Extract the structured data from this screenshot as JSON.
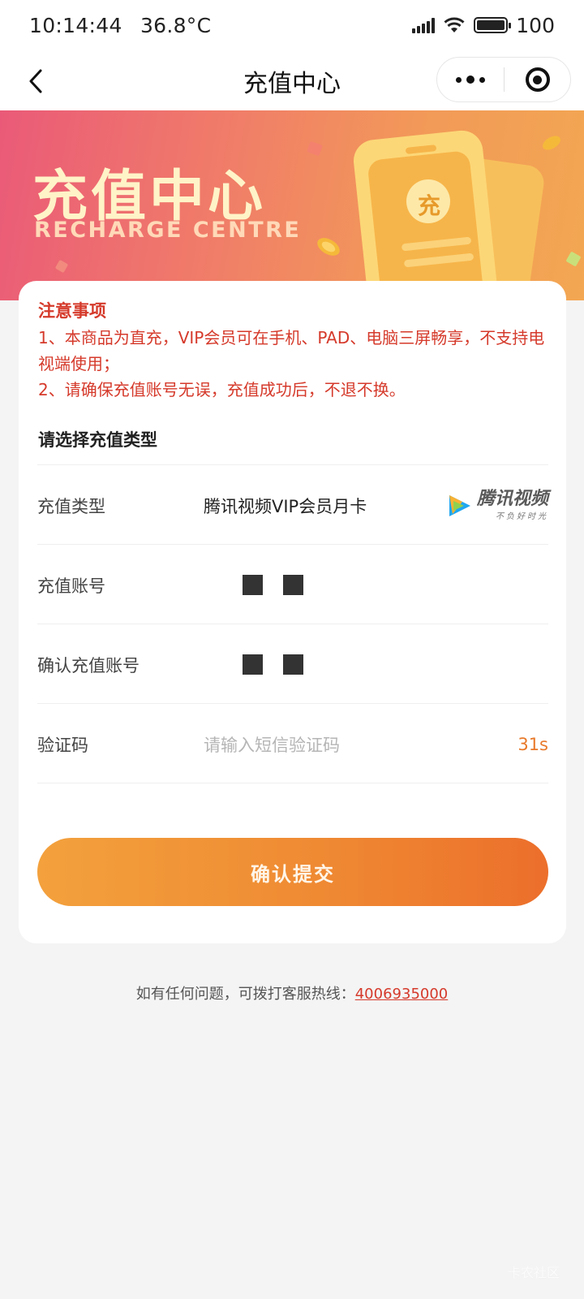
{
  "status_bar": {
    "time": "10:14:44",
    "temperature": "36.8°C",
    "battery": "100"
  },
  "nav": {
    "title": "充值中心"
  },
  "banner": {
    "title": "充值中心",
    "subtitle": "RECHARGE CENTRE",
    "badge_char": "充"
  },
  "notice": {
    "heading": "注意事项",
    "line1": "1、本商品为直充，VIP会员可在手机、PAD、电脑三屏畅享，不支持电视端使用；",
    "line2": "2、请确保充值账号无误，充值成功后，不退不换。"
  },
  "form": {
    "section_title": "请选择充值类型",
    "type_label": "充值类型",
    "type_value": "腾讯视频VIP会员月卡",
    "type_logo_name": "腾讯视频",
    "type_logo_slogan": "不负好时光",
    "account_label": "充值账号",
    "confirm_label": "确认充值账号",
    "code_label": "验证码",
    "code_placeholder": "请输入短信验证码",
    "countdown": "31s",
    "submit_label": "确认提交"
  },
  "footer": {
    "text": "如有任何问题，可拨打客服热线：",
    "phone": "4006935000"
  },
  "watermark": "卡农社区",
  "colors": {
    "accent": "#ef8a33",
    "notice": "#d53a2b"
  }
}
